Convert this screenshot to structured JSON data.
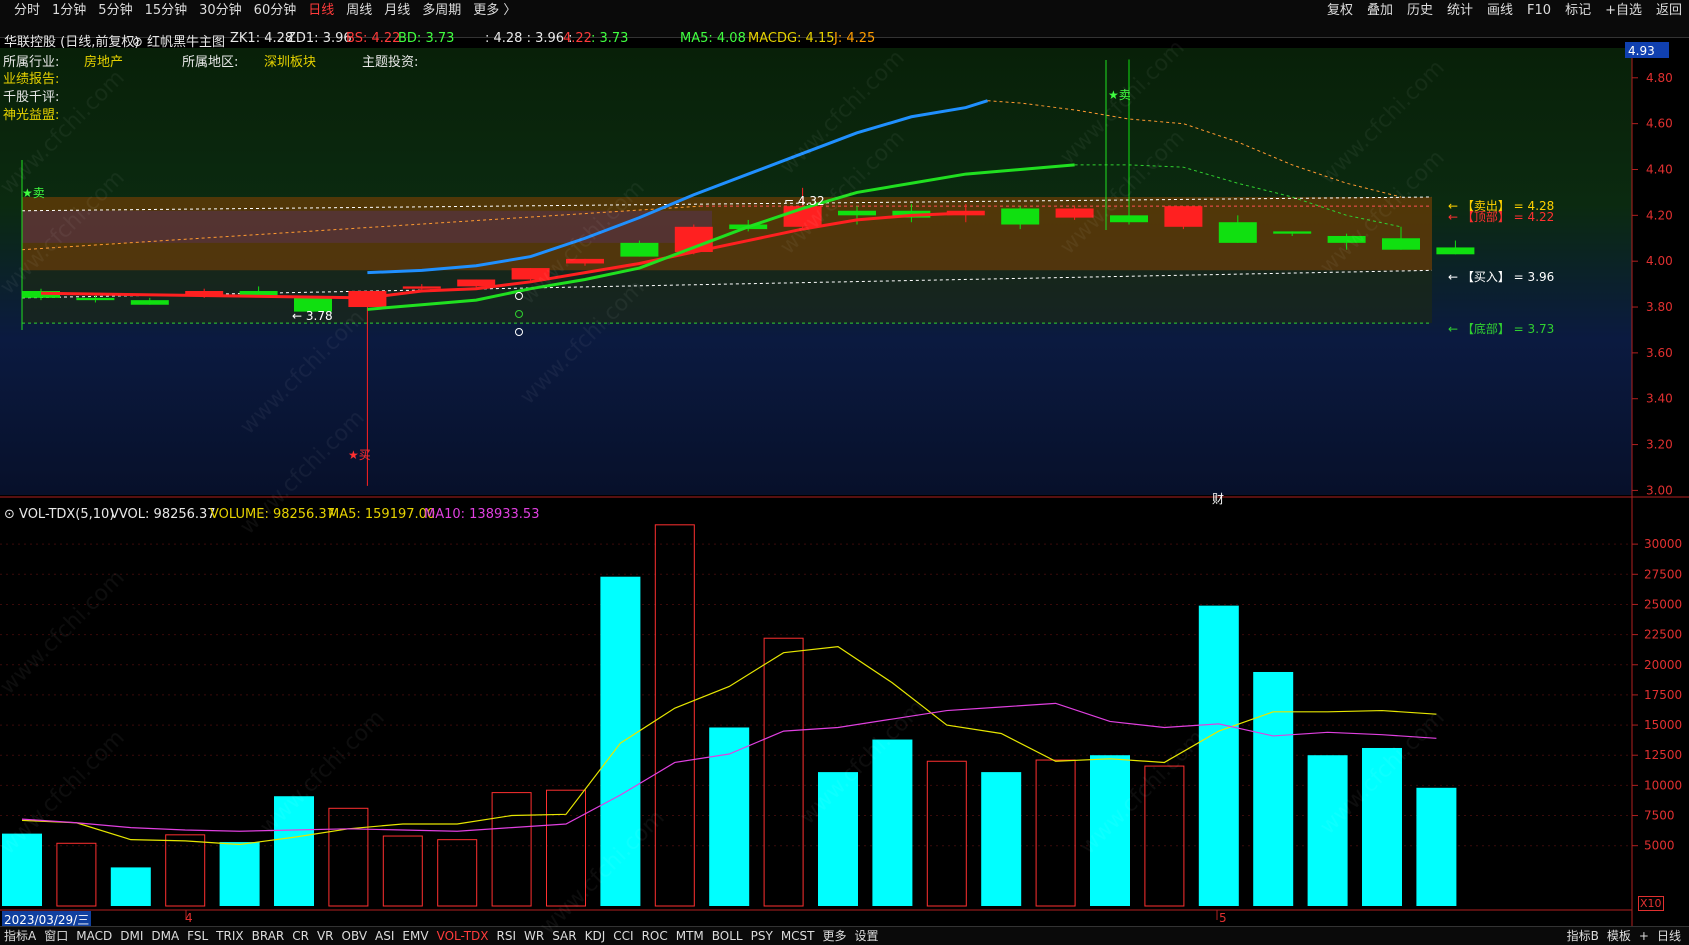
{
  "toolbar": {
    "periods": [
      "分时",
      "1分钟",
      "5分钟",
      "15分钟",
      "30分钟",
      "60分钟",
      "日线",
      "周线",
      "月线",
      "多周期",
      "更多 〉"
    ],
    "active_period": "日线",
    "right_items": [
      "复权",
      "叠加",
      "历史",
      "统计",
      "画线",
      "F10",
      "标记",
      "+自选",
      "返回"
    ]
  },
  "info": {
    "title": "华联控股 (日线,前复权)",
    "indicator": "红帆黑牛主图",
    "zk1": "ZK1: 4.28",
    "zd1": "ZD1: 3.96",
    "bs": "BS: 4.22",
    "bd": "BD: 3.73",
    "ohlc_a": ": 4.28 : 3.96 :",
    "ohlc_b": "4.22",
    "ohlc_c": ": 3.73",
    "ma5": "MA5: 4.08",
    "macdg": "MACDG: 4.15",
    "j": "J: 4.25",
    "current_price": "4.93"
  },
  "meta": {
    "industry_label": "所属行业:",
    "industry_value": "房地产",
    "region_label": "所属地区:",
    "region_value": "深圳板块",
    "theme_label": "主题投资:",
    "report_label": "业绩报告:",
    "review_label": "千股千评:",
    "divine_label": "神光益盟:"
  },
  "levels": {
    "sell": "← 【卖出】 = 4.28",
    "top": "← 【顶部】 = 4.22",
    "buy": "← 【买入】 = 3.96",
    "bottom": "← 【底部】 = 3.73"
  },
  "annotations": {
    "sell_star_left": "★卖",
    "sell_star_right": "★卖",
    "buy_star": "★买",
    "high_label": "4.32",
    "low_label": "3.78",
    "cai": "财"
  },
  "vol_header": {
    "name": "VOL-TDX(5,10)",
    "vvol": "VVOL: 98256.37",
    "volume": "VOLUME: 98256.37",
    "ma5": "MA5: 159197.00",
    "ma10": "MA10: 138933.53"
  },
  "date_bar": {
    "date": "2023/03/29/三",
    "m4": "4",
    "m5": "5",
    "scale": "X10"
  },
  "bottom_tabs": [
    "指标A",
    "窗口",
    "MACD",
    "DMI",
    "DMA",
    "FSL",
    "TRIX",
    "BRAR",
    "CR",
    "VR",
    "OBV",
    "ASI",
    "EMV",
    "VOL-TDX",
    "RSI",
    "WR",
    "SAR",
    "KDJ",
    "CCI",
    "ROC",
    "MTM",
    "BOLL",
    "PSY",
    "MCST",
    "更多",
    "设置"
  ],
  "bottom_active": "VOL-TDX",
  "bottom_right": [
    "指标B",
    "模板",
    "+",
    "日线"
  ],
  "watermark": "www.cfchi.com",
  "chart_data": [
    {
      "type": "candlestick",
      "title": "红帆黑牛主图",
      "y_ticks": [
        3.0,
        3.2,
        3.4,
        3.6,
        3.8,
        4.0,
        4.2,
        4.4,
        4.6,
        4.8
      ],
      "ylim": [
        2.98,
        4.93
      ],
      "candles": [
        {
          "o": 3.84,
          "c": 3.87,
          "h": 3.88,
          "l": 3.83,
          "up": false
        },
        {
          "o": 3.84,
          "c": 3.83,
          "h": 3.85,
          "l": 3.82,
          "up": false
        },
        {
          "o": 3.83,
          "c": 3.81,
          "h": 3.84,
          "l": 3.81,
          "up": false
        },
        {
          "o": 3.85,
          "c": 3.87,
          "h": 3.88,
          "l": 3.84,
          "up": true
        },
        {
          "o": 3.85,
          "c": 3.87,
          "h": 3.89,
          "l": 3.85,
          "up": false
        },
        {
          "o": 3.84,
          "c": 3.78,
          "h": 3.84,
          "l": 3.78,
          "up": false
        },
        {
          "o": 3.8,
          "c": 3.87,
          "h": 3.87,
          "l": 3.02,
          "up": true
        },
        {
          "o": 3.89,
          "c": 3.88,
          "h": 3.9,
          "l": 3.87,
          "up": true
        },
        {
          "o": 3.89,
          "c": 3.92,
          "h": 3.92,
          "l": 3.88,
          "up": true
        },
        {
          "o": 3.92,
          "c": 3.97,
          "h": 3.97,
          "l": 3.91,
          "up": true
        },
        {
          "o": 3.99,
          "c": 4.01,
          "h": 4.01,
          "l": 3.98,
          "up": true
        },
        {
          "o": 4.08,
          "c": 4.02,
          "h": 4.09,
          "l": 4.02,
          "up": false
        },
        {
          "o": 4.04,
          "c": 4.15,
          "h": 4.16,
          "l": 4.03,
          "up": true
        },
        {
          "o": 4.16,
          "c": 4.14,
          "h": 4.18,
          "l": 4.13,
          "up": false
        },
        {
          "o": 4.15,
          "c": 4.24,
          "h": 4.32,
          "l": 4.14,
          "up": true
        },
        {
          "o": 4.2,
          "c": 4.22,
          "h": 4.24,
          "l": 4.16,
          "up": false
        },
        {
          "o": 4.22,
          "c": 4.19,
          "h": 4.25,
          "l": 4.17,
          "up": false
        },
        {
          "o": 4.2,
          "c": 4.22,
          "h": 4.25,
          "l": 4.17,
          "up": true
        },
        {
          "o": 4.23,
          "c": 4.16,
          "h": 4.24,
          "l": 4.14,
          "up": false
        },
        {
          "o": 4.23,
          "c": 4.19,
          "h": 4.24,
          "l": 4.18,
          "up": true
        },
        {
          "o": 4.2,
          "c": 4.17,
          "h": 4.88,
          "l": 4.16,
          "up": false
        },
        {
          "o": 4.24,
          "c": 4.15,
          "h": 4.24,
          "l": 4.14,
          "up": true
        },
        {
          "o": 4.17,
          "c": 4.08,
          "h": 4.2,
          "l": 4.08,
          "up": false
        },
        {
          "o": 4.12,
          "c": 4.13,
          "h": 4.13,
          "l": 4.11,
          "up": false
        },
        {
          "o": 4.11,
          "c": 4.08,
          "h": 4.12,
          "l": 4.05,
          "up": false
        },
        {
          "o": 4.1,
          "c": 4.05,
          "h": 4.15,
          "l": 4.05,
          "up": false
        },
        {
          "o": 4.06,
          "c": 4.03,
          "h": 4.09,
          "l": 4.03,
          "up": false
        }
      ],
      "ma_blue": [
        [
          6,
          3.95
        ],
        [
          7,
          3.96
        ],
        [
          8,
          3.98
        ],
        [
          9,
          4.02
        ],
        [
          10,
          4.1
        ],
        [
          11,
          4.19
        ],
        [
          12,
          4.29
        ],
        [
          13,
          4.38
        ],
        [
          14,
          4.47
        ],
        [
          15,
          4.56
        ],
        [
          16,
          4.63
        ],
        [
          17,
          4.67
        ],
        [
          17.4,
          4.7
        ]
      ],
      "ma_green": [
        [
          6,
          3.79
        ],
        [
          7,
          3.81
        ],
        [
          8,
          3.83
        ],
        [
          9,
          3.88
        ],
        [
          10,
          3.92
        ],
        [
          11,
          3.97
        ],
        [
          12,
          4.06
        ],
        [
          13,
          4.15
        ],
        [
          14,
          4.23
        ],
        [
          15,
          4.3
        ],
        [
          16,
          4.34
        ],
        [
          17,
          4.38
        ],
        [
          18,
          4.4
        ],
        [
          19,
          4.42
        ]
      ],
      "ma_red": [
        [
          0,
          3.86
        ],
        [
          6,
          3.84
        ],
        [
          7,
          3.87
        ],
        [
          8,
          3.88
        ],
        [
          9,
          3.91
        ],
        [
          10,
          3.95
        ],
        [
          11,
          3.99
        ],
        [
          12,
          4.04
        ],
        [
          13,
          4.09
        ],
        [
          14,
          4.14
        ],
        [
          15,
          4.18
        ],
        [
          16,
          4.2
        ],
        [
          17,
          4.21
        ]
      ],
      "ma_dotted_orange": [
        [
          17.4,
          4.7
        ],
        [
          18,
          4.69
        ],
        [
          19,
          4.66
        ],
        [
          20,
          4.62
        ],
        [
          21,
          4.6
        ],
        [
          22,
          4.52
        ],
        [
          23,
          4.42
        ],
        [
          24,
          4.34
        ],
        [
          25,
          4.28
        ]
      ],
      "ma_dotted_green": [
        [
          19,
          4.42
        ],
        [
          20,
          4.42
        ],
        [
          21,
          4.41
        ],
        [
          22,
          4.34
        ],
        [
          23,
          4.28
        ],
        [
          24,
          4.2
        ],
        [
          25,
          4.15
        ]
      ],
      "band_upper": 4.22,
      "band_mid": 3.96,
      "band_lower": 3.73,
      "blue_zone": [
        4.22,
        4.08
      ]
    },
    {
      "type": "bar",
      "title": "VOL-TDX(5,10)",
      "y_ticks": [
        5000,
        7500,
        10000,
        12500,
        15000,
        17500,
        20000,
        22500,
        25000,
        27500,
        30000
      ],
      "ylim": [
        0,
        32000
      ],
      "volumes": [
        {
          "v": 6000,
          "up": false
        },
        {
          "v": 5200,
          "up": true
        },
        {
          "v": 3200,
          "up": false
        },
        {
          "v": 5900,
          "up": true
        },
        {
          "v": 5300,
          "up": false
        },
        {
          "v": 9100,
          "up": false
        },
        {
          "v": 8100,
          "up": true
        },
        {
          "v": 5800,
          "up": true
        },
        {
          "v": 5500,
          "up": true
        },
        {
          "v": 9400,
          "up": true
        },
        {
          "v": 9600,
          "up": true
        },
        {
          "v": 27300,
          "up": false
        },
        {
          "v": 31600,
          "up": true
        },
        {
          "v": 14800,
          "up": false
        },
        {
          "v": 22200,
          "up": true
        },
        {
          "v": 11100,
          "up": false
        },
        {
          "v": 13800,
          "up": false
        },
        {
          "v": 12000,
          "up": true
        },
        {
          "v": 11100,
          "up": false
        },
        {
          "v": 12100,
          "up": true
        },
        {
          "v": 12500,
          "up": false
        },
        {
          "v": 11600,
          "up": true
        },
        {
          "v": 24900,
          "up": false
        },
        {
          "v": 19400,
          "up": false
        },
        {
          "v": 12500,
          "up": false
        },
        {
          "v": 13100,
          "up": false
        },
        {
          "v": 9800,
          "up": false
        }
      ],
      "ma5_line": [
        7100,
        6900,
        5500,
        5400,
        5100,
        5700,
        6400,
        6800,
        6800,
        7500,
        7600,
        13500,
        16400,
        18200,
        21000,
        21500,
        18500,
        15000,
        14300,
        12000,
        12200,
        11900,
        14500,
        16100,
        16100,
        16200,
        15900
      ],
      "ma10_line": [
        7200,
        6900,
        6500,
        6300,
        6200,
        6300,
        6400,
        6300,
        6200,
        6500,
        6800,
        9200,
        11900,
        12600,
        14500,
        14800,
        15500,
        16200,
        16500,
        16800,
        15300,
        14800,
        15100,
        14100,
        14400,
        14200,
        13900
      ]
    }
  ]
}
